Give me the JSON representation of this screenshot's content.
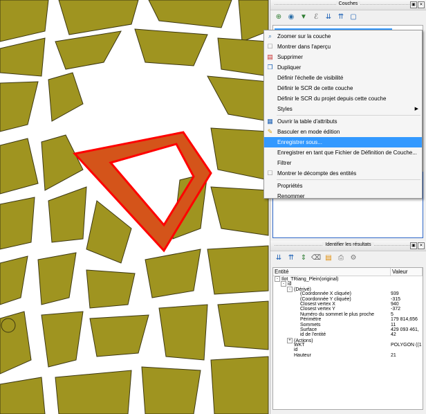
{
  "map": {
    "fill_color": "#9f9420",
    "stroke_color": "#3b3611",
    "selected_fill": "#d4541a",
    "selected_stroke": "#ff0000"
  },
  "layers_panel": {
    "title": "Couches",
    "toolbar": [
      "add-layer-icon",
      "visibility-icon",
      "filter-icon",
      "expression-icon",
      "expand-all-icon",
      "collapse-all-icon",
      "remove-layer-icon"
    ]
  },
  "context_menu": {
    "items": [
      {
        "label": "Zoomer sur la couche",
        "icon": "zoom-icon"
      },
      {
        "label": "Montrer dans l'aperçu",
        "icon": "checkbox-icon"
      },
      {
        "label": "Supprimer",
        "icon": "delete-icon"
      },
      {
        "label": "Dupliquer",
        "icon": "duplicate-icon"
      },
      {
        "label": "Définir l'échelle de visibilité",
        "icon": ""
      },
      {
        "label": "Définir le SCR de cette couche",
        "icon": ""
      },
      {
        "label": "Définir le SCR du projet depuis cette couche",
        "icon": ""
      },
      {
        "label": "Styles",
        "icon": "",
        "submenu": true
      },
      {
        "label": "Ouvrir la table d'attributs",
        "icon": "table-icon"
      },
      {
        "label": "Basculer en mode édition",
        "icon": "pencil-icon"
      },
      {
        "label": "Enregistrer sous...",
        "icon": "",
        "highlighted": true
      },
      {
        "label": "Enregistrer en tant que Fichier de Définition de Couche...",
        "icon": ""
      },
      {
        "label": "Filtrer",
        "icon": ""
      },
      {
        "label": "Montrer le décompte des entités",
        "icon": "checkbox-icon"
      },
      {
        "label": "Propriétés",
        "icon": ""
      },
      {
        "label": "Renommer",
        "icon": ""
      }
    ]
  },
  "identify_panel": {
    "title": "Identifier les résultats",
    "headers": [
      "Entité",
      "Valeur"
    ],
    "rows": [
      {
        "indent": 0,
        "exp": "-",
        "key": "Ilot_TRiang_Plein(original)",
        "val": ""
      },
      {
        "indent": 1,
        "exp": "-",
        "key": "id",
        "val": ""
      },
      {
        "indent": 2,
        "exp": "-",
        "key": "(Dérivé)",
        "val": ""
      },
      {
        "indent": 3,
        "exp": "",
        "key": "(Coordonnée X cliquée)",
        "val": "939"
      },
      {
        "indent": 3,
        "exp": "",
        "key": "(Coordonnée Y cliquée)",
        "val": "-315"
      },
      {
        "indent": 3,
        "exp": "",
        "key": "Closest vertex X",
        "val": "940"
      },
      {
        "indent": 3,
        "exp": "",
        "key": "Closest vertex Y",
        "val": "-372"
      },
      {
        "indent": 3,
        "exp": "",
        "key": "Numéro du sommet le plus proche",
        "val": "5"
      },
      {
        "indent": 3,
        "exp": "",
        "key": "Périmètre",
        "val": "179 814,656"
      },
      {
        "indent": 3,
        "exp": "",
        "key": "Sommets",
        "val": "11"
      },
      {
        "indent": 3,
        "exp": "",
        "key": "Surface",
        "val": "429 093 461,"
      },
      {
        "indent": 3,
        "exp": "",
        "key": "id de l'entité",
        "val": "42"
      },
      {
        "indent": 2,
        "exp": "+",
        "key": "(Actions)",
        "val": ""
      },
      {
        "indent": 2,
        "exp": "",
        "key": "WKT",
        "val": "POLYGON ((1"
      },
      {
        "indent": 2,
        "exp": "",
        "key": "id",
        "val": ""
      },
      {
        "indent": 2,
        "exp": "",
        "key": "Hauteur",
        "val": "21"
      }
    ]
  }
}
